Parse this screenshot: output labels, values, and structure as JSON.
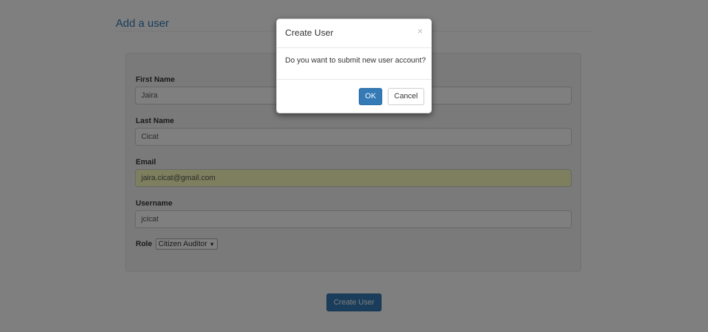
{
  "page": {
    "title": "Add a user"
  },
  "form": {
    "first_name": {
      "label": "First Name",
      "value": "Jaira"
    },
    "last_name": {
      "label": "Last Name",
      "value": "Cicat"
    },
    "email": {
      "label": "Email",
      "value": "jaira.cicat@gmail.com"
    },
    "username": {
      "label": "Username",
      "value": "jcicat"
    },
    "role": {
      "label": "Role",
      "selected": "Citizen Auditor",
      "caret_icon": "caret-down-icon"
    }
  },
  "actions": {
    "create_label": "Create User"
  },
  "modal": {
    "title": "Create User",
    "close_glyph": "×",
    "message": "Do you want to submit new user account?",
    "ok_label": "OK",
    "cancel_label": "Cancel"
  },
  "colors": {
    "accent": "#337ab7",
    "autofill": "#faffbd",
    "backdrop": "rgba(0,0,0,0.5)"
  }
}
